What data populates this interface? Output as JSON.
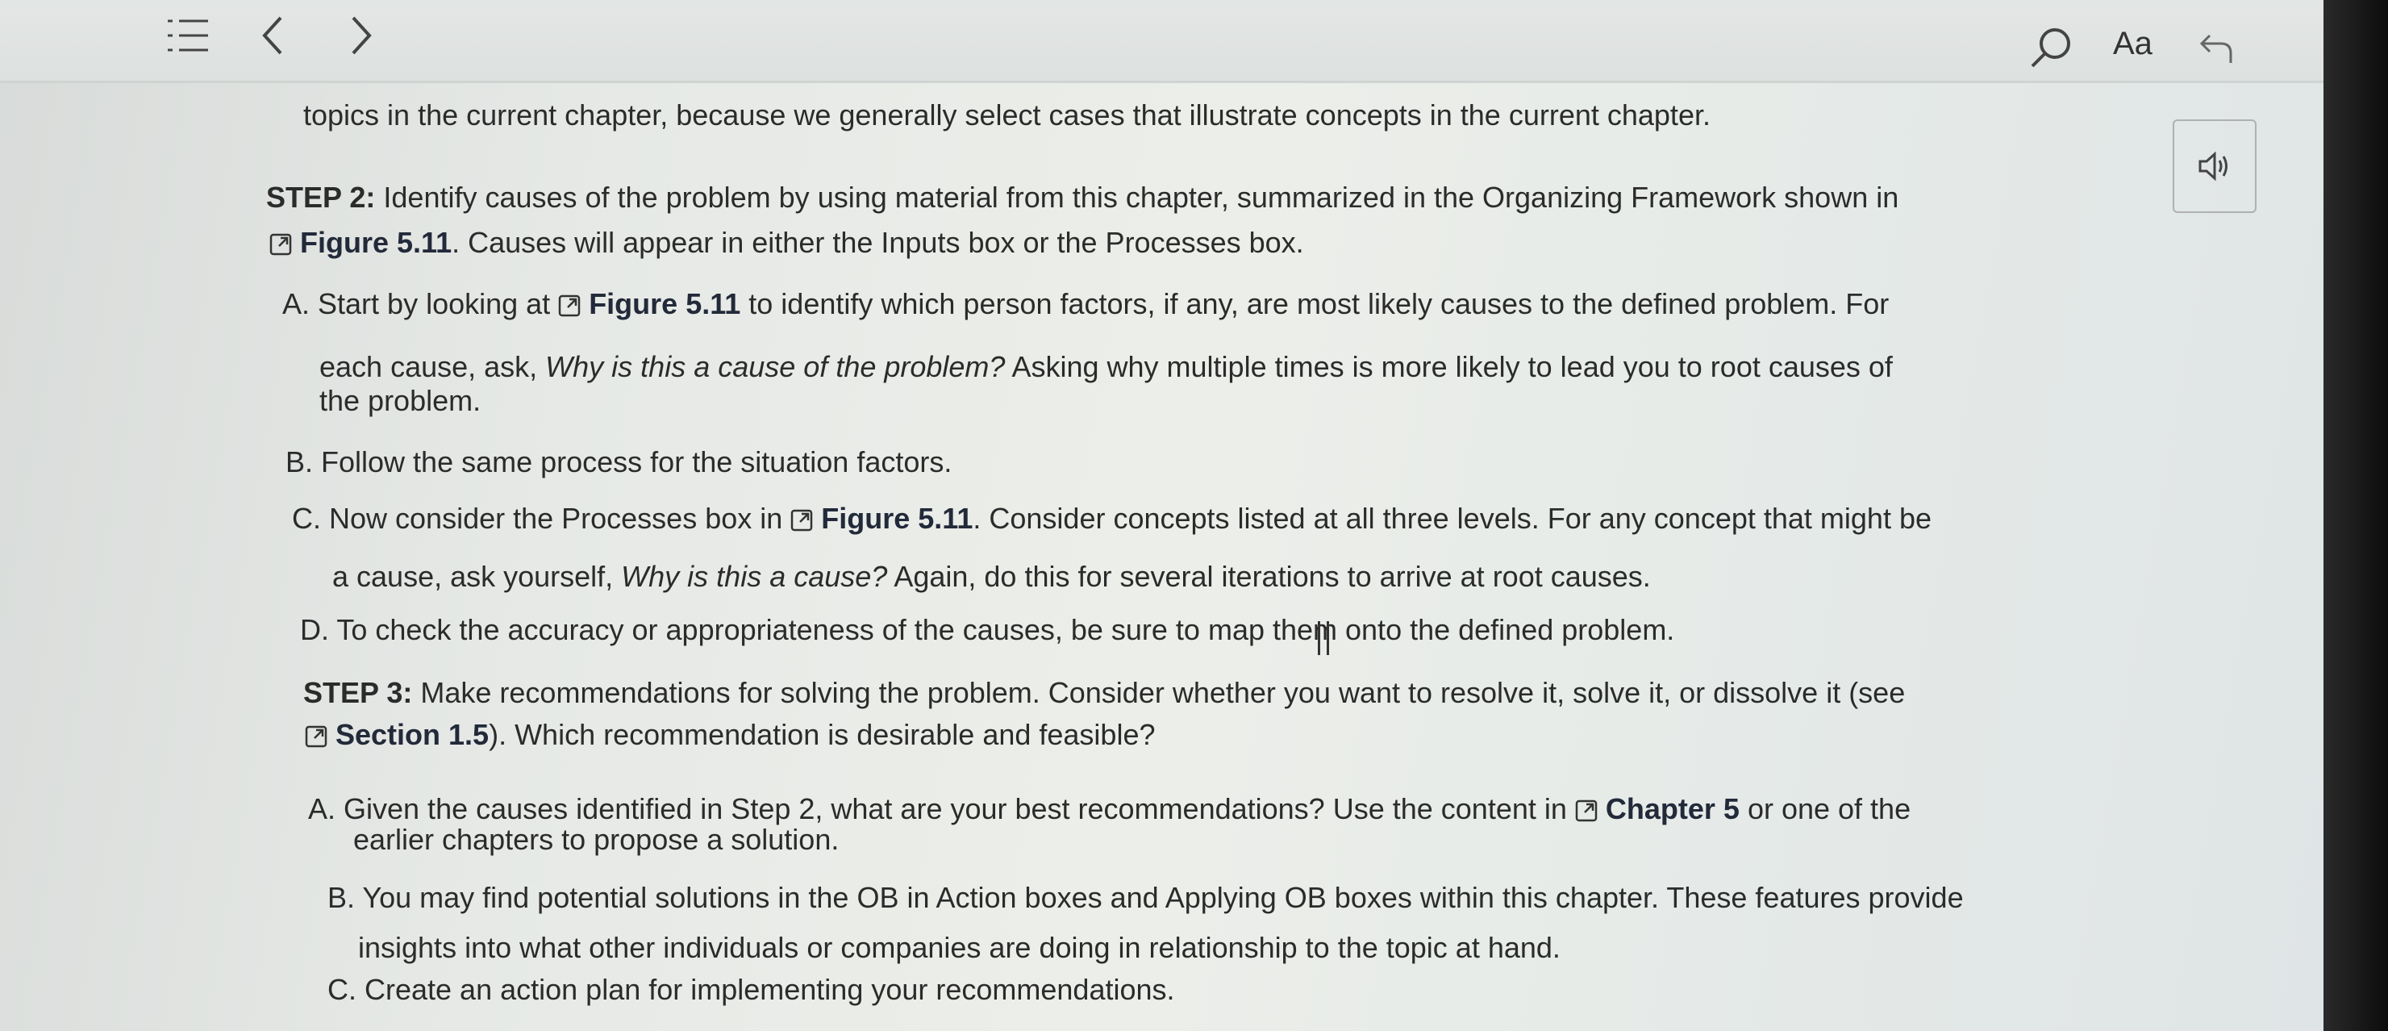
{
  "toolbar": {
    "font_label": "Aa"
  },
  "content": {
    "intro_line": "topics in the current chapter, because we generally select cases that illustrate concepts in the current chapter.",
    "step2": {
      "head": "STEP 2:",
      "line1": " Identify causes of the problem by using material from this chapter, summarized in the Organizing Framework shown in",
      "fig_ref": "Figure 5.11",
      "line2_rest": ". Causes will appear in either the Inputs box or the Processes box.",
      "A_pre": "A. Start by looking at ",
      "A_fig": "Figure 5.11",
      "A_post": " to identify which person factors, if any, are most likely causes to the defined problem. For",
      "A_line2_pre": "each cause, ask, ",
      "A_line2_ital": "Why is this a cause of the problem?",
      "A_line2_post": " Asking why multiple times is more likely to lead you to root causes of",
      "A_line3": "the problem.",
      "B": "B. Follow the same process for the situation factors.",
      "C_pre": "C. Now consider the Processes box in ",
      "C_fig": "Figure 5.11",
      "C_post": ". Consider concepts listed at all three levels. For any concept that might be",
      "C_line2_pre": "a cause, ask yourself, ",
      "C_line2_ital": "Why is this a cause?",
      "C_line2_post": " Again, do this for several iterations to arrive at root causes.",
      "D": "D. To check the accuracy or appropriateness of the causes, be sure to map them onto the defined problem."
    },
    "step3": {
      "head": "STEP 3:",
      "line1": " Make recommendations for solving the problem. Consider whether you want to resolve it, solve it, or dissolve it (see",
      "section_ref": "Section 1.5",
      "line2_rest": "). Which recommendation is desirable and feasible?",
      "A_pre": "A. Given the causes identified in Step 2, what are your best recommendations? Use the content in ",
      "A_chapter": "Chapter 5",
      "A_post": " or one of the",
      "A_line2": "earlier chapters to propose a solution.",
      "B_line1": "B. You may find potential solutions in the OB in Action boxes and Applying OB boxes within this chapter. These features provide",
      "B_line2": "insights into what other individuals or companies are doing in relationship to the topic at hand.",
      "C": "C. Create an action plan for implementing your recommendations."
    }
  },
  "colors": {
    "text": "#2b2b2b",
    "toolbar_bg": "#e3e6e4",
    "link": "#222a3a"
  },
  "icons": [
    "toc-icon",
    "chevron-left-icon",
    "chevron-right-icon",
    "search-icon",
    "undo-icon",
    "speaker-icon",
    "external-link-icon"
  ]
}
